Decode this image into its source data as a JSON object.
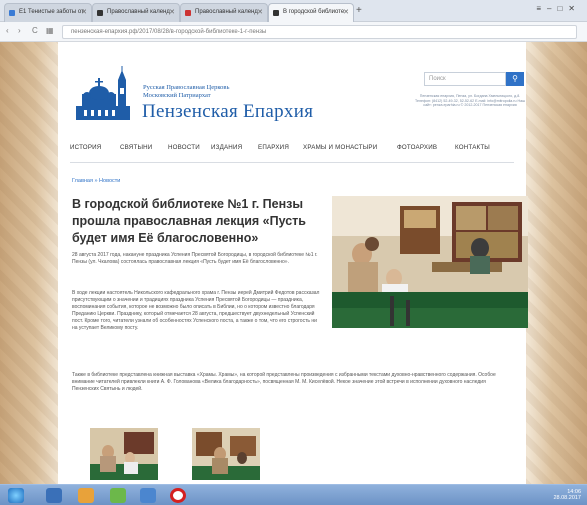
{
  "browser": {
    "tabs": [
      {
        "label": "E1 Тенистые заботы от"
      },
      {
        "label": "Православный календ"
      },
      {
        "label": "Православный календ"
      },
      {
        "label": "В городской библиоте"
      }
    ],
    "new_tab": "+",
    "url": "пензенская-епархия.рф/2017/08/28/в-городской-библиотеке-1-г-пензы"
  },
  "site": {
    "org_line1": "Русская Православная Церковь",
    "org_line2": "Московский Патриархат",
    "eparchy": "Пензенская Епархия",
    "search_placeholder": "Поиск",
    "contact_text": "Пензенская епархия, Пенза, ул. Богдана Хмельницкого, д.8. Телефон: (8412) 52-49-32, 52-52-62 E-mail: info@mitropolia.ru Наш сайт: penza.eparhia.ru © 2012-2017 Пензенская епархия"
  },
  "menu": [
    "ИСТОРИЯ",
    "СВЯТЫНИ",
    "НОВОСТИ",
    "ИЗДАНИЯ",
    "ЕПАРХИЯ",
    "ХРАМЫ И МОНАСТЫРИ",
    "ФОТОАРХИВ",
    "КОНТАКТЫ"
  ],
  "breadcrumb": "Главная » Новости",
  "article": {
    "title": "В городской библиотеке №1 г. Пензы прошла православная лекция «Пусть будет имя Её благословенно»",
    "p1": "28 августа 2017 года, накануне праздника Успения Пресвятой Богородицы, в городской библиотеке №1 г. Пензы (ул. Чкалова) состоялась православная лекция «Пусть будет имя Её благословенно».",
    "p2": "В ходе лекции настоятель Никольского кафедрального храма г. Пензы иерей Дмитрий Федотов рассказал присутствующим о значении и традициях праздника Успения Пресвятой Богородицы — праздника, воспоминания события, которое не возможно было описать в Библии, но о котором известно благодаря Преданию Церкви. Празднику, который отмечается 28 августа, предшествует двухнедельный Успенский пост. Кроме того, читатели узнали об особенностях Успенского поста, а также о том, что его строгость ни на уступает Великому посту.",
    "p3": "Также в библиотеке представлена книжная выставка «Храмы. Храмы», на которой представлены произведения с избранными текстами духовно-нравственного содержания. Особое внимание читателей привлекли книги А. Ф. Голованова «Велика благодарность», посвященная М. М. Киселёвой. Некое значение этой встречи в исполнении духовного наследия Пензенских Святынь и людей."
  },
  "taskbar": {
    "time": "14:06",
    "date": "28.08.2017"
  }
}
